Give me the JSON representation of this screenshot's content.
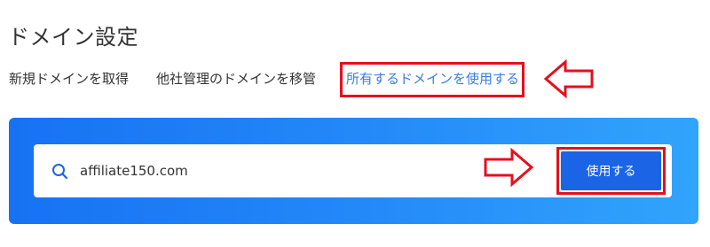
{
  "page": {
    "title": "ドメイン設定"
  },
  "tabs": [
    {
      "label": "新規ドメインを取得"
    },
    {
      "label": "他社管理のドメインを移管"
    },
    {
      "label": "所有するドメインを使用する"
    }
  ],
  "search": {
    "value": "affiliate150.com"
  },
  "actions": {
    "use_label": "使用する"
  },
  "colors": {
    "accent": "#1b64e6",
    "highlight": "#e4101e",
    "active_tab": "#3a7de0"
  },
  "icons": {
    "search": "search-icon",
    "annotation": "arrow-icon"
  }
}
